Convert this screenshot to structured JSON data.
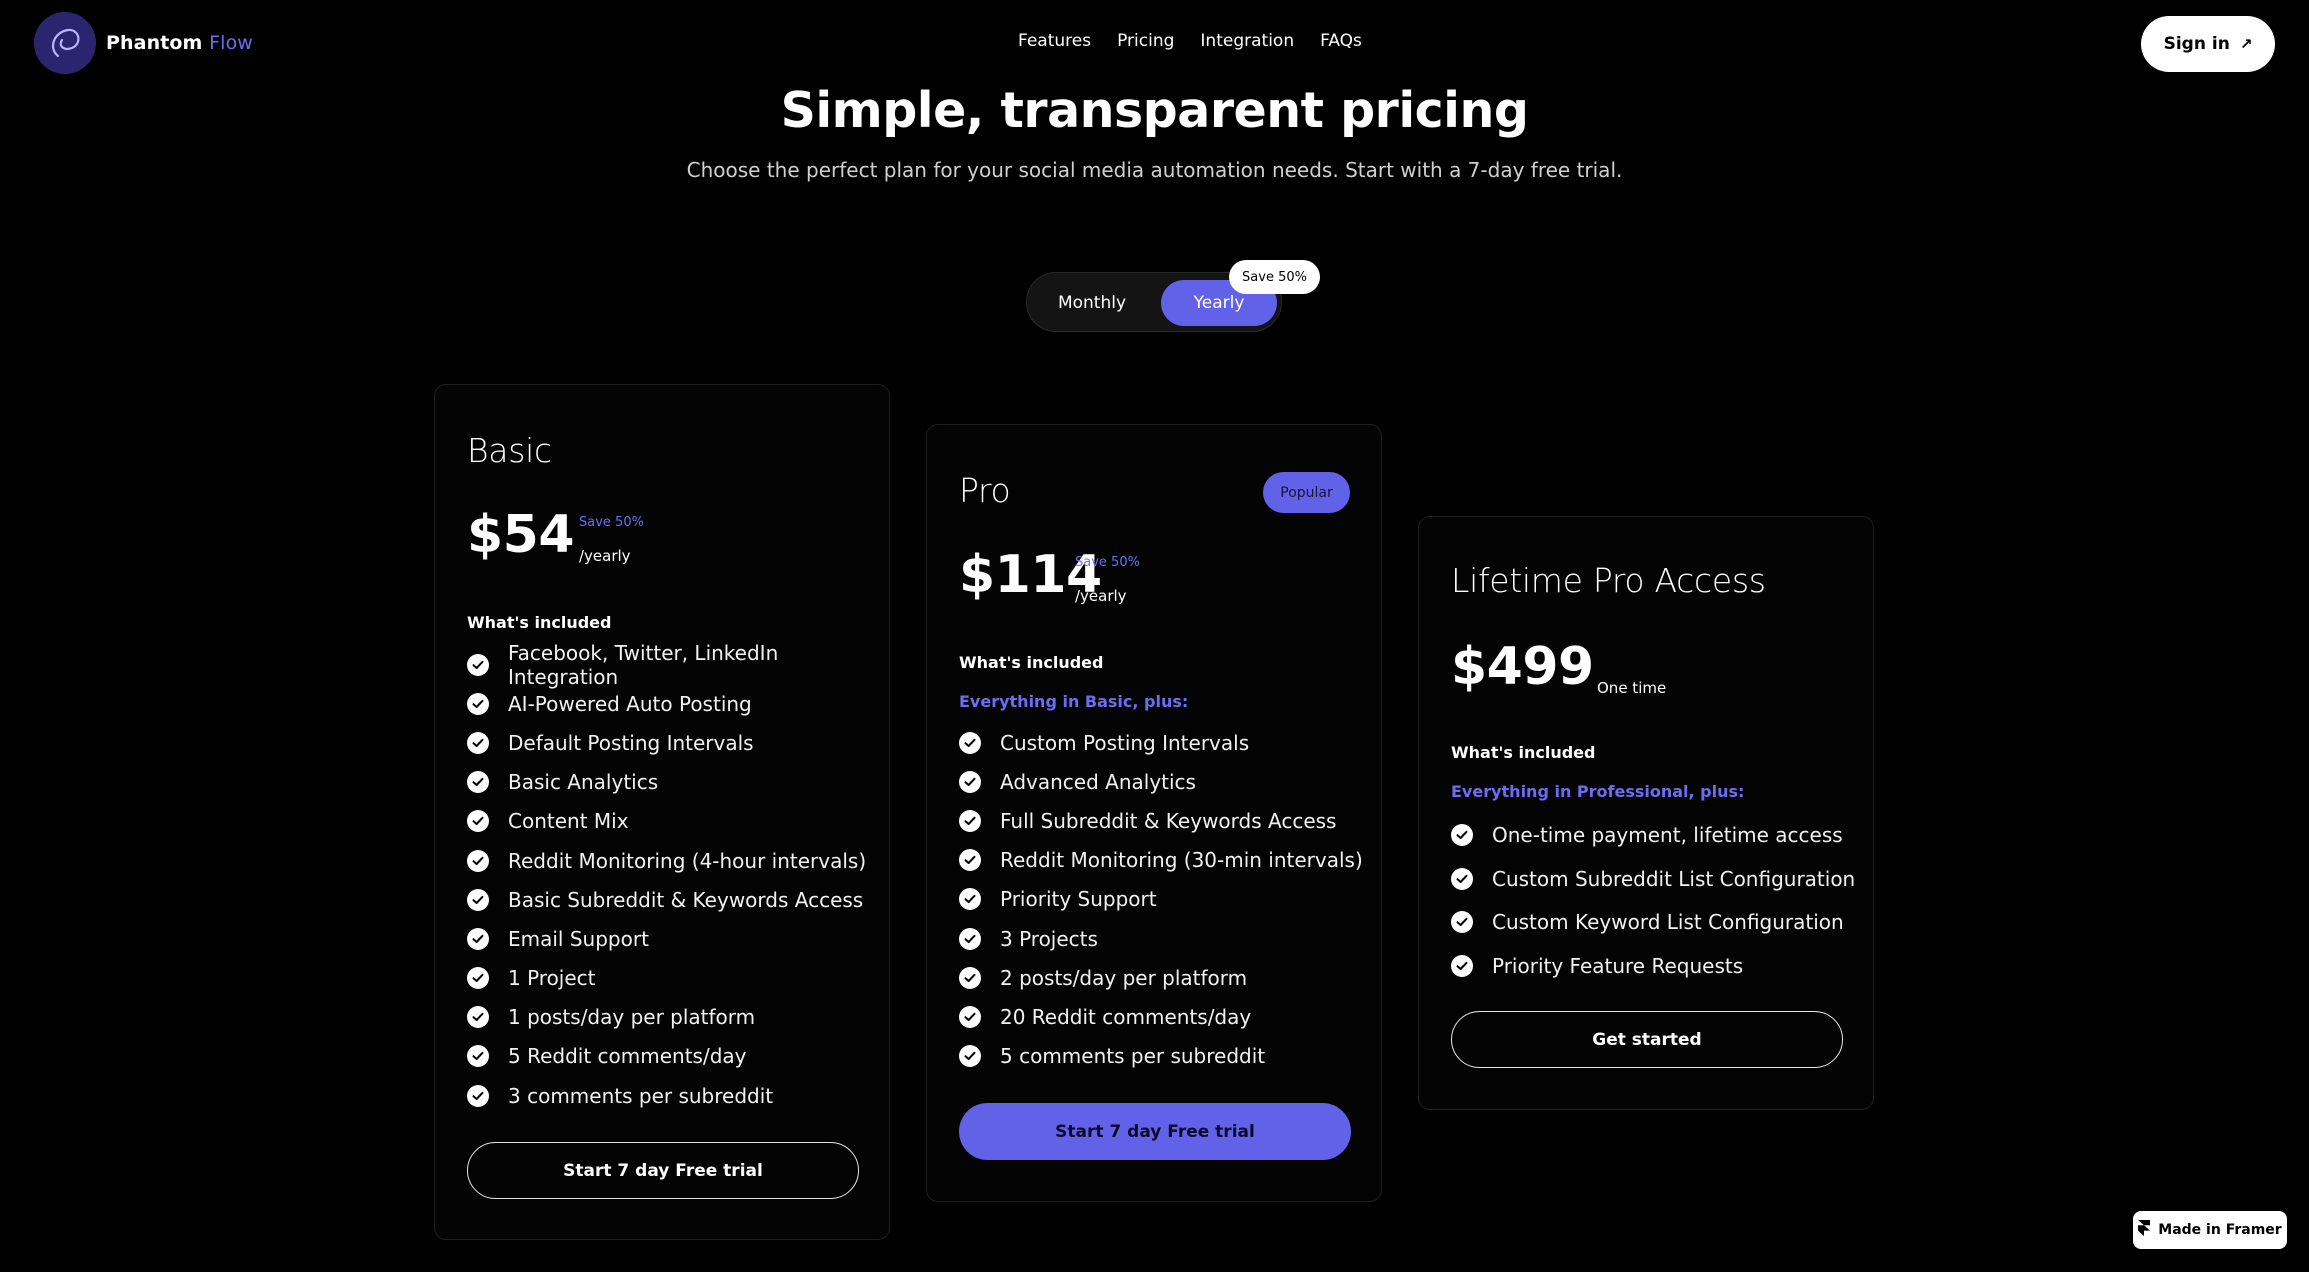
{
  "brand": {
    "name_primary": "Phantom",
    "name_accent": "Flow",
    "accent_color": "#6262e8"
  },
  "nav": {
    "links": [
      "Features",
      "Pricing",
      "Integration",
      "FAQs"
    ],
    "signin_label": "Sign in",
    "signin_icon": "arrow-up-right-icon"
  },
  "hero": {
    "title": "Simple, transparent pricing",
    "subtitle": "Choose the perfect plan for your social media automation needs. Start with a 7-day free trial."
  },
  "billing_toggle": {
    "monthly_label": "Monthly",
    "yearly_label": "Yearly",
    "selected": "Yearly",
    "save_badge": "Save 50%"
  },
  "plans": [
    {
      "name": "Basic",
      "price": "$54",
      "save": "Save 50%",
      "period": "/yearly",
      "included_label": "What's included",
      "plus_line": "",
      "features": [
        "Facebook, Twitter, LinkedIn Integration",
        "AI-Powered Auto Posting",
        "Default Posting Intervals",
        "Basic Analytics",
        "Content Mix",
        "Reddit Monitoring (4-hour intervals)",
        "Basic Subreddit & Keywords Access",
        "Email Support",
        "1 Project",
        "1 posts/day per platform",
        "5 Reddit comments/day",
        "3 comments per subreddit"
      ],
      "cta": "Start 7 day Free trial"
    },
    {
      "name": "Pro",
      "badge": "Popular",
      "price": "$114",
      "save": "Save 50%",
      "period": "/yearly",
      "included_label": "What's included",
      "plus_line": "Everything in Basic, plus:",
      "features": [
        "Custom Posting Intervals",
        "Advanced Analytics",
        "Full Subreddit & Keywords Access",
        "Reddit Monitoring (30-min intervals)",
        "Priority Support",
        "3 Projects",
        "2 posts/day per platform",
        "20 Reddit comments/day",
        "5 comments per subreddit"
      ],
      "cta": "Start 7 day Free trial"
    },
    {
      "name": "Lifetime Pro Access",
      "price": "$499",
      "period": "One time",
      "included_label": "What's included",
      "plus_line": "Everything in Professional, plus:",
      "features": [
        "One-time payment, lifetime access",
        "Custom Subreddit List Configuration",
        "Custom Keyword List Configuration",
        "Priority Feature Requests"
      ],
      "cta": "Get started"
    }
  ],
  "framer_badge": {
    "label": "Made in Framer",
    "icon": "framer-logo-icon"
  }
}
